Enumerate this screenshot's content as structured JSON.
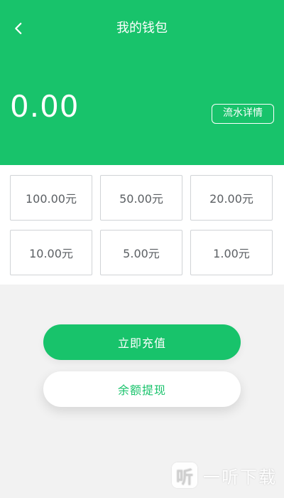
{
  "header": {
    "title": "我的钱包",
    "balance": "0.00",
    "flow_button_label": "流水详情",
    "back_icon": "chevron-left-icon"
  },
  "amounts": [
    "100.00元",
    "50.00元",
    "20.00元",
    "10.00元",
    "5.00元",
    "1.00元"
  ],
  "actions": {
    "recharge_label": "立即充值",
    "withdraw_label": "余额提现"
  },
  "watermark": {
    "icon_text": "听",
    "label": "一听下载"
  },
  "colors": {
    "primary": "#18c36b",
    "background": "#f2f2f2",
    "card_border": "#d0d3d6",
    "amount_text": "#5b5f63"
  }
}
